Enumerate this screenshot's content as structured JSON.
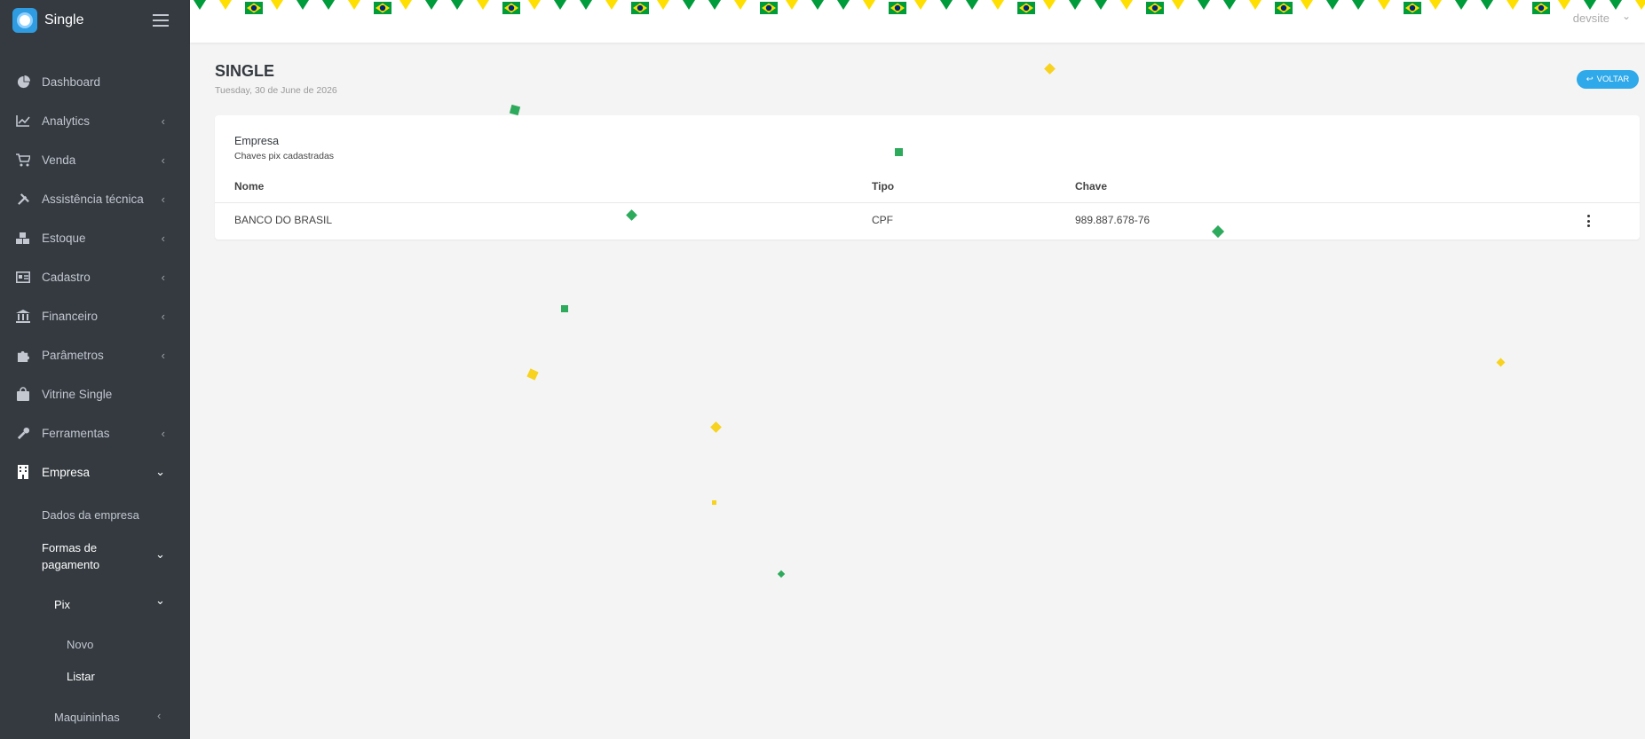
{
  "app": {
    "name": "Single",
    "user": "devsite"
  },
  "sidebar": {
    "items": [
      {
        "label": "Dashboard",
        "icon": "chart-pie-icon",
        "has_chevron": false
      },
      {
        "label": "Analytics",
        "icon": "line-chart-icon",
        "has_chevron": true
      },
      {
        "label": "Venda",
        "icon": "cart-icon",
        "has_chevron": true
      },
      {
        "label": "Assistência técnica",
        "icon": "tools-icon",
        "has_chevron": true
      },
      {
        "label": "Estoque",
        "icon": "boxes-icon",
        "has_chevron": true
      },
      {
        "label": "Cadastro",
        "icon": "id-card-icon",
        "has_chevron": true
      },
      {
        "label": "Financeiro",
        "icon": "bank-icon",
        "has_chevron": true
      },
      {
        "label": "Parâmetros",
        "icon": "puzzle-icon",
        "has_chevron": true
      },
      {
        "label": "Vitrine Single",
        "icon": "shopping-bag-icon",
        "has_chevron": false
      },
      {
        "label": "Ferramentas",
        "icon": "wrench-icon",
        "has_chevron": true
      },
      {
        "label": "Empresa",
        "icon": "building-icon",
        "has_chevron": true,
        "open": true
      }
    ],
    "empresa_sub": {
      "dados": "Dados da empresa",
      "formas_line1": "Formas de",
      "formas_line2": "pagamento",
      "pix": "Pix",
      "novo": "Novo",
      "listar": "Listar",
      "maquininhas": "Maquininhas"
    }
  },
  "page": {
    "title": "SINGLE",
    "date": "Tuesday, 30 de June de 2026",
    "back_label": "VOLTAR"
  },
  "card": {
    "title": "Empresa",
    "subtitle": "Chaves pix cadastradas",
    "columns": [
      "Nome",
      "Tipo",
      "Chave"
    ],
    "rows": [
      {
        "nome": "BANCO DO BRASIL",
        "tipo": "CPF",
        "chave": "989.887.678-76"
      }
    ]
  },
  "colors": {
    "sidebar_bg": "#343a40",
    "accent": "#2fa9e9",
    "green": "#2eaa5c",
    "yellow": "#f7d21e",
    "flag_green": "#009b3a",
    "flag_yellow": "#fedf00",
    "flag_blue": "#002776"
  }
}
